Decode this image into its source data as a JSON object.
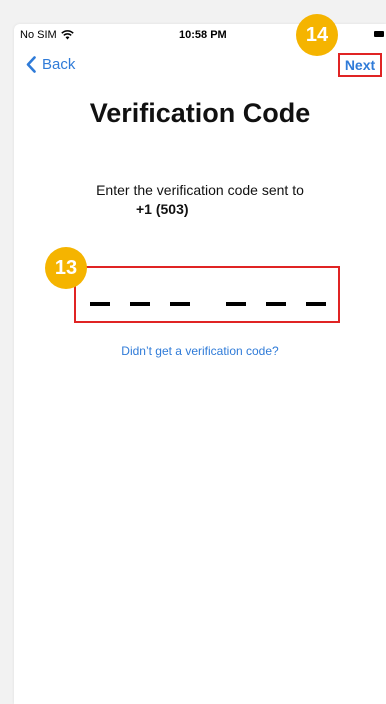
{
  "status_bar": {
    "carrier": "No SIM",
    "wifi_icon": "wifi-icon",
    "time": "10:58 PM",
    "battery_icon": "battery-icon"
  },
  "nav": {
    "back_label": "Back",
    "back_icon": "chevron-left-icon",
    "next_label": "Next"
  },
  "title": "Verification Code",
  "instruction": "Enter the verification code sent to",
  "phone_number": "+1 (503)",
  "code": {
    "digits": 6,
    "groups": [
      3,
      3
    ]
  },
  "resend_label": "Didn’t get a verification code?",
  "badges": {
    "code_badge": "13",
    "next_badge": "14"
  },
  "colors": {
    "accent": "#2f7bd8",
    "highlight": "#e02424",
    "badge": "#f5b400"
  }
}
